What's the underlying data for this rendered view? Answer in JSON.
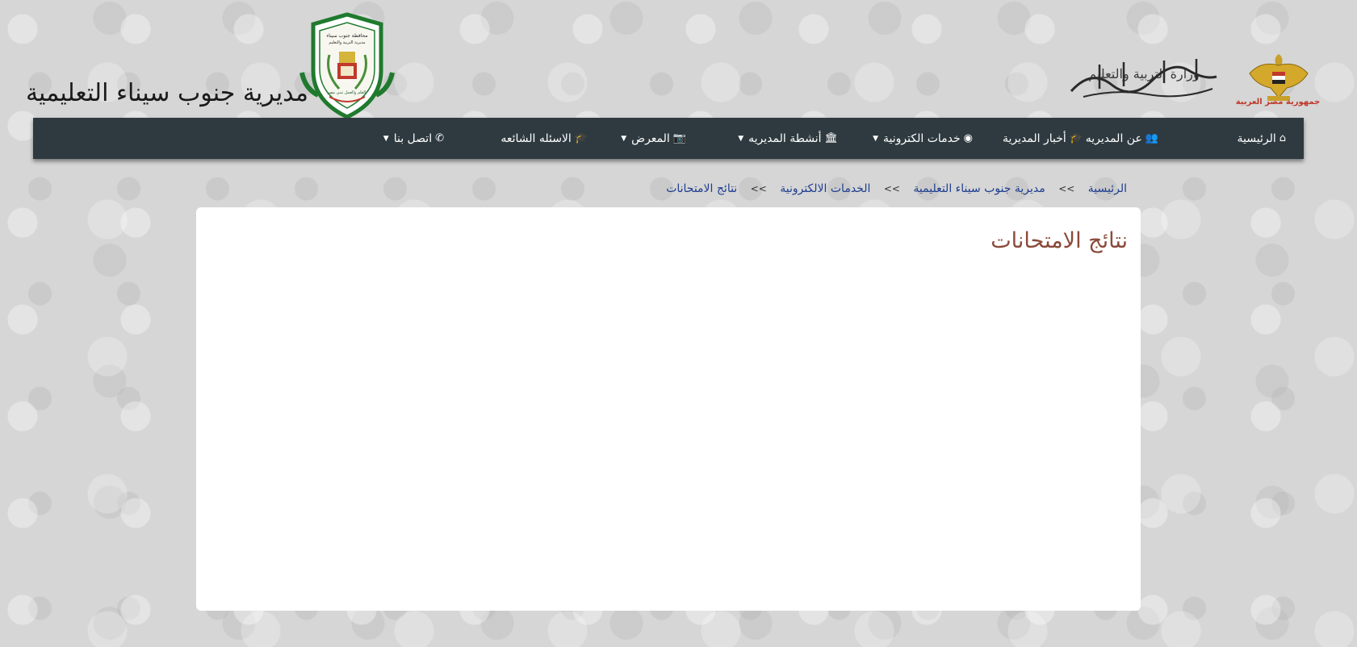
{
  "header": {
    "site_title": "مديرية جنوب سيناء التعليمية",
    "crest_top_text": "محافظة جنوب سيناء",
    "crest_sub_text": "مديرية التربية والتعليم",
    "crest_motto": "بالعلم والعمل نبني مصر",
    "ministry_text": "وزارة التربية والتعليم",
    "republic_text": "جمهورية مصر العربية"
  },
  "nav": {
    "items": [
      {
        "label": "الرئيسية",
        "icon": "home-icon",
        "glyph": "⌂",
        "has_caret": false
      },
      {
        "label": "عن المديريه",
        "icon": "users-icon",
        "glyph": "👥",
        "has_caret": true
      },
      {
        "label": "أخبار المديرية",
        "icon": "graduation-cap-icon",
        "glyph": "🎓",
        "has_caret": false
      },
      {
        "label": "خدمات الكترونية",
        "icon": "globe-icon",
        "glyph": "◉",
        "has_caret": true
      },
      {
        "label": "أنشطة المديريه",
        "icon": "institution-icon",
        "glyph": "🏛",
        "has_caret": true
      },
      {
        "label": "المعرض",
        "icon": "camera-icon",
        "glyph": "📷",
        "has_caret": true
      },
      {
        "label": "الاسئله الشائعه",
        "icon": "graduation-cap-icon",
        "glyph": "🎓",
        "has_caret": false
      },
      {
        "label": "اتصل بنا",
        "icon": "phone-icon",
        "glyph": "✆",
        "has_caret": true
      }
    ],
    "caret_glyph": "▼"
  },
  "breadcrumb": {
    "items": [
      "الرئيسية",
      "مديرية جنوب سيناء التعليمية",
      "الخدمات الالكترونية",
      "نتائج الامتحانات"
    ],
    "separator": ">>"
  },
  "content": {
    "title": "نتائج الامتحانات"
  },
  "colors": {
    "navbar": "#2e3a40",
    "title": "#8a4a3a",
    "link": "#1d3d8f"
  }
}
